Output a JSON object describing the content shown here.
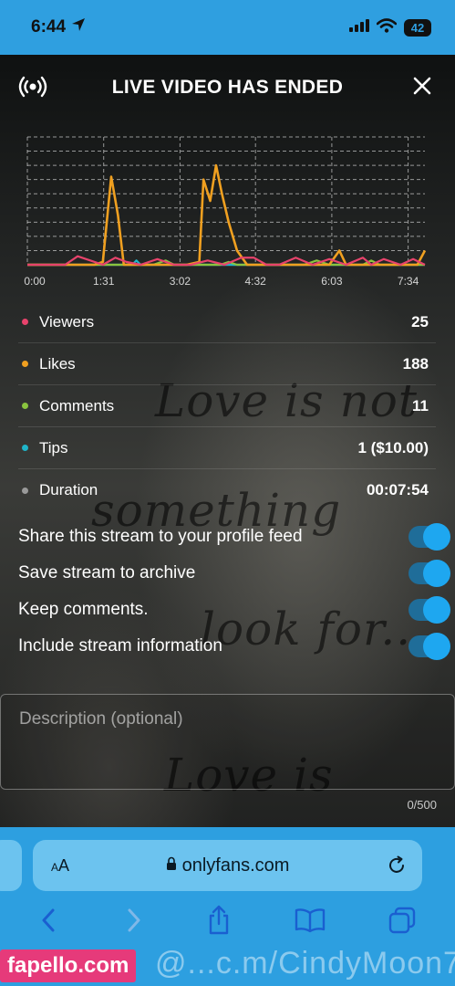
{
  "status_bar": {
    "time": "6:44",
    "battery": "42"
  },
  "header": {
    "title": "LIVE VIDEO HAS ENDED"
  },
  "chart_data": {
    "type": "line",
    "x_tick_labels": [
      "0:00",
      "1:31",
      "3:02",
      "4:32",
      "6:03",
      "7:34"
    ],
    "x_ticks_seconds": [
      0,
      91,
      182,
      272,
      363,
      454
    ],
    "x_range_seconds": [
      0,
      474
    ],
    "ylim": [
      0,
      9
    ],
    "grid": true,
    "series": [
      {
        "name": "Viewers",
        "color": "#e8436c",
        "points": [
          [
            0,
            0
          ],
          [
            20,
            0
          ],
          [
            45,
            0
          ],
          [
            60,
            0.6
          ],
          [
            75,
            0.3
          ],
          [
            90,
            0
          ],
          [
            105,
            0.5
          ],
          [
            118,
            0.2
          ],
          [
            135,
            0
          ],
          [
            155,
            0.4
          ],
          [
            175,
            0
          ],
          [
            195,
            0
          ],
          [
            215,
            0.3
          ],
          [
            235,
            0
          ],
          [
            255,
            0.5
          ],
          [
            270,
            0.5
          ],
          [
            285,
            0
          ],
          [
            300,
            0
          ],
          [
            320,
            0.5
          ],
          [
            340,
            0
          ],
          [
            360,
            0.4
          ],
          [
            380,
            0
          ],
          [
            400,
            0.5
          ],
          [
            410,
            0
          ],
          [
            425,
            0.4
          ],
          [
            445,
            0
          ],
          [
            460,
            0.4
          ],
          [
            474,
            0
          ]
        ]
      },
      {
        "name": "Likes",
        "color": "#f0a020",
        "points": [
          [
            0,
            0
          ],
          [
            70,
            0
          ],
          [
            80,
            0
          ],
          [
            90,
            0.2
          ],
          [
            100,
            6.2
          ],
          [
            108,
            3.5
          ],
          [
            115,
            0
          ],
          [
            190,
            0
          ],
          [
            205,
            0.2
          ],
          [
            210,
            6
          ],
          [
            218,
            4.5
          ],
          [
            225,
            7
          ],
          [
            232,
            5
          ],
          [
            240,
            3
          ],
          [
            250,
            1
          ],
          [
            262,
            0
          ],
          [
            360,
            0
          ],
          [
            372,
            1
          ],
          [
            380,
            0
          ],
          [
            465,
            0
          ],
          [
            474,
            1
          ]
        ]
      },
      {
        "name": "Comments",
        "color": "#8ac43e",
        "points": [
          [
            0,
            0
          ],
          [
            150,
            0
          ],
          [
            165,
            0.3
          ],
          [
            175,
            0
          ],
          [
            230,
            0
          ],
          [
            240,
            0.2
          ],
          [
            250,
            0
          ],
          [
            330,
            0
          ],
          [
            345,
            0.3
          ],
          [
            360,
            0
          ],
          [
            400,
            0
          ],
          [
            410,
            0.3
          ],
          [
            420,
            0
          ],
          [
            474,
            0
          ]
        ]
      },
      {
        "name": "Tips",
        "color": "#1fb4c9",
        "points": [
          [
            0,
            0
          ],
          [
            125,
            0
          ],
          [
            130,
            0.3
          ],
          [
            135,
            0
          ],
          [
            474,
            0
          ]
        ]
      },
      {
        "name": "Duration",
        "color": "#9a9a9a",
        "points": [
          [
            0,
            0
          ],
          [
            474,
            0
          ]
        ]
      }
    ]
  },
  "stats": [
    {
      "label": "Viewers",
      "value": "25",
      "color": "#e8436c"
    },
    {
      "label": "Likes",
      "value": "188",
      "color": "#f0a020"
    },
    {
      "label": "Comments",
      "value": "11",
      "color": "#8ac43e"
    },
    {
      "label": "Tips",
      "value": "1 ($10.00)",
      "color": "#1fb4c9"
    },
    {
      "label": "Duration",
      "value": "00:07:54",
      "color": "#9a9a9a"
    }
  ],
  "toggles": [
    {
      "label": "Share this stream to your profile feed",
      "on": true
    },
    {
      "label": "Save stream to archive",
      "on": true
    },
    {
      "label": "Keep comments.",
      "on": true
    },
    {
      "label": "Include stream information",
      "on": true
    }
  ],
  "description": {
    "placeholder": "Description (optional)",
    "counter": "0/500"
  },
  "browser": {
    "text_size_label": "AA",
    "url": "onlyfans.com"
  },
  "background_text": [
    "Love is not",
    "something",
    "look for...",
    "Love is"
  ],
  "watermark": {
    "site": "fapello.com",
    "handle": "@...c.m/CindyMoon7"
  }
}
